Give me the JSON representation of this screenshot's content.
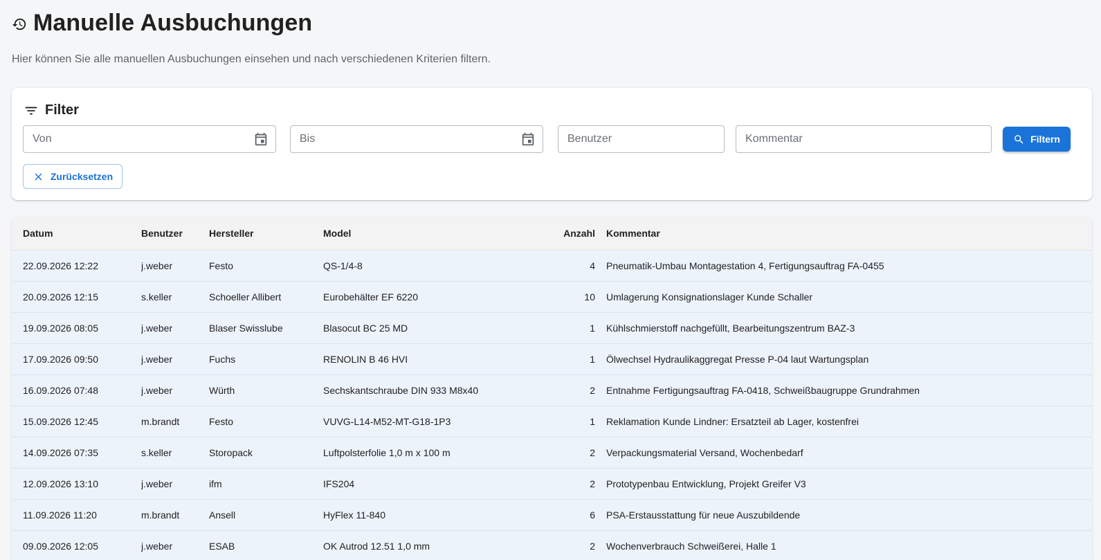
{
  "header": {
    "title": "Manuelle Ausbuchungen",
    "subtitle": "Hier können Sie alle manuellen Ausbuchungen einsehen und nach verschiedenen Kriterien filtern."
  },
  "filter": {
    "title": "Filter",
    "von_placeholder": "Von",
    "bis_placeholder": "Bis",
    "benutzer_placeholder": "Benutzer",
    "kommentar_placeholder": "Kommentar",
    "filter_button": "Filtern",
    "reset_button": "Zurücksetzen"
  },
  "colors": {
    "primary": "#1a73d8",
    "row_background": "#edf3fb",
    "header_background": "#f3f3f3"
  },
  "table": {
    "columns": [
      "Datum",
      "Benutzer",
      "Hersteller",
      "Model",
      "Anzahl",
      "Kommentar"
    ],
    "rows": [
      {
        "datum": "22.09.2026 12:22",
        "benutzer": "j.weber",
        "hersteller": "Festo",
        "model": "QS-1/4-8",
        "anzahl": "4",
        "kommentar": "Pneumatik-Umbau Montagestation 4, Fertigungsauftrag FA-0455"
      },
      {
        "datum": "20.09.2026 12:15",
        "benutzer": "s.keller",
        "hersteller": "Schoeller Allibert",
        "model": "Eurobehälter EF 6220",
        "anzahl": "10",
        "kommentar": "Umlagerung Konsignationslager Kunde Schaller"
      },
      {
        "datum": "19.09.2026 08:05",
        "benutzer": "j.weber",
        "hersteller": "Blaser Swisslube",
        "model": "Blasocut BC 25 MD",
        "anzahl": "1",
        "kommentar": "Kühlschmierstoff nachgefüllt, Bearbeitungszentrum BAZ-3"
      },
      {
        "datum": "17.09.2026 09:50",
        "benutzer": "j.weber",
        "hersteller": "Fuchs",
        "model": "RENOLIN B 46 HVI",
        "anzahl": "1",
        "kommentar": "Ölwechsel Hydraulikaggregat Presse P-04 laut Wartungsplan"
      },
      {
        "datum": "16.09.2026 07:48",
        "benutzer": "j.weber",
        "hersteller": "Würth",
        "model": "Sechskantschraube DIN 933 M8x40",
        "anzahl": "2",
        "kommentar": "Entnahme Fertigungsauftrag FA-0418, Schweißbaugruppe Grundrahmen"
      },
      {
        "datum": "15.09.2026 12:45",
        "benutzer": "m.brandt",
        "hersteller": "Festo",
        "model": "VUVG-L14-M52-MT-G18-1P3",
        "anzahl": "1",
        "kommentar": "Reklamation Kunde Lindner: Ersatzteil ab Lager, kostenfrei"
      },
      {
        "datum": "14.09.2026 07:35",
        "benutzer": "s.keller",
        "hersteller": "Storopack",
        "model": "Luftpolsterfolie 1,0 m x 100 m",
        "anzahl": "2",
        "kommentar": "Verpackungsmaterial Versand, Wochenbedarf"
      },
      {
        "datum": "12.09.2026 13:10",
        "benutzer": "j.weber",
        "hersteller": "ifm",
        "model": "IFS204",
        "anzahl": "2",
        "kommentar": "Prototypenbau Entwicklung, Projekt Greifer V3"
      },
      {
        "datum": "11.09.2026 11:20",
        "benutzer": "m.brandt",
        "hersteller": "Ansell",
        "model": "HyFlex 11-840",
        "anzahl": "6",
        "kommentar": "PSA-Erstausstattung für neue Auszubildende"
      },
      {
        "datum": "09.09.2026 12:05",
        "benutzer": "j.weber",
        "hersteller": "ESAB",
        "model": "OK Autrod 12.51 1,0 mm",
        "anzahl": "2",
        "kommentar": "Wochenverbrauch Schweißerei, Halle 1"
      }
    ]
  }
}
